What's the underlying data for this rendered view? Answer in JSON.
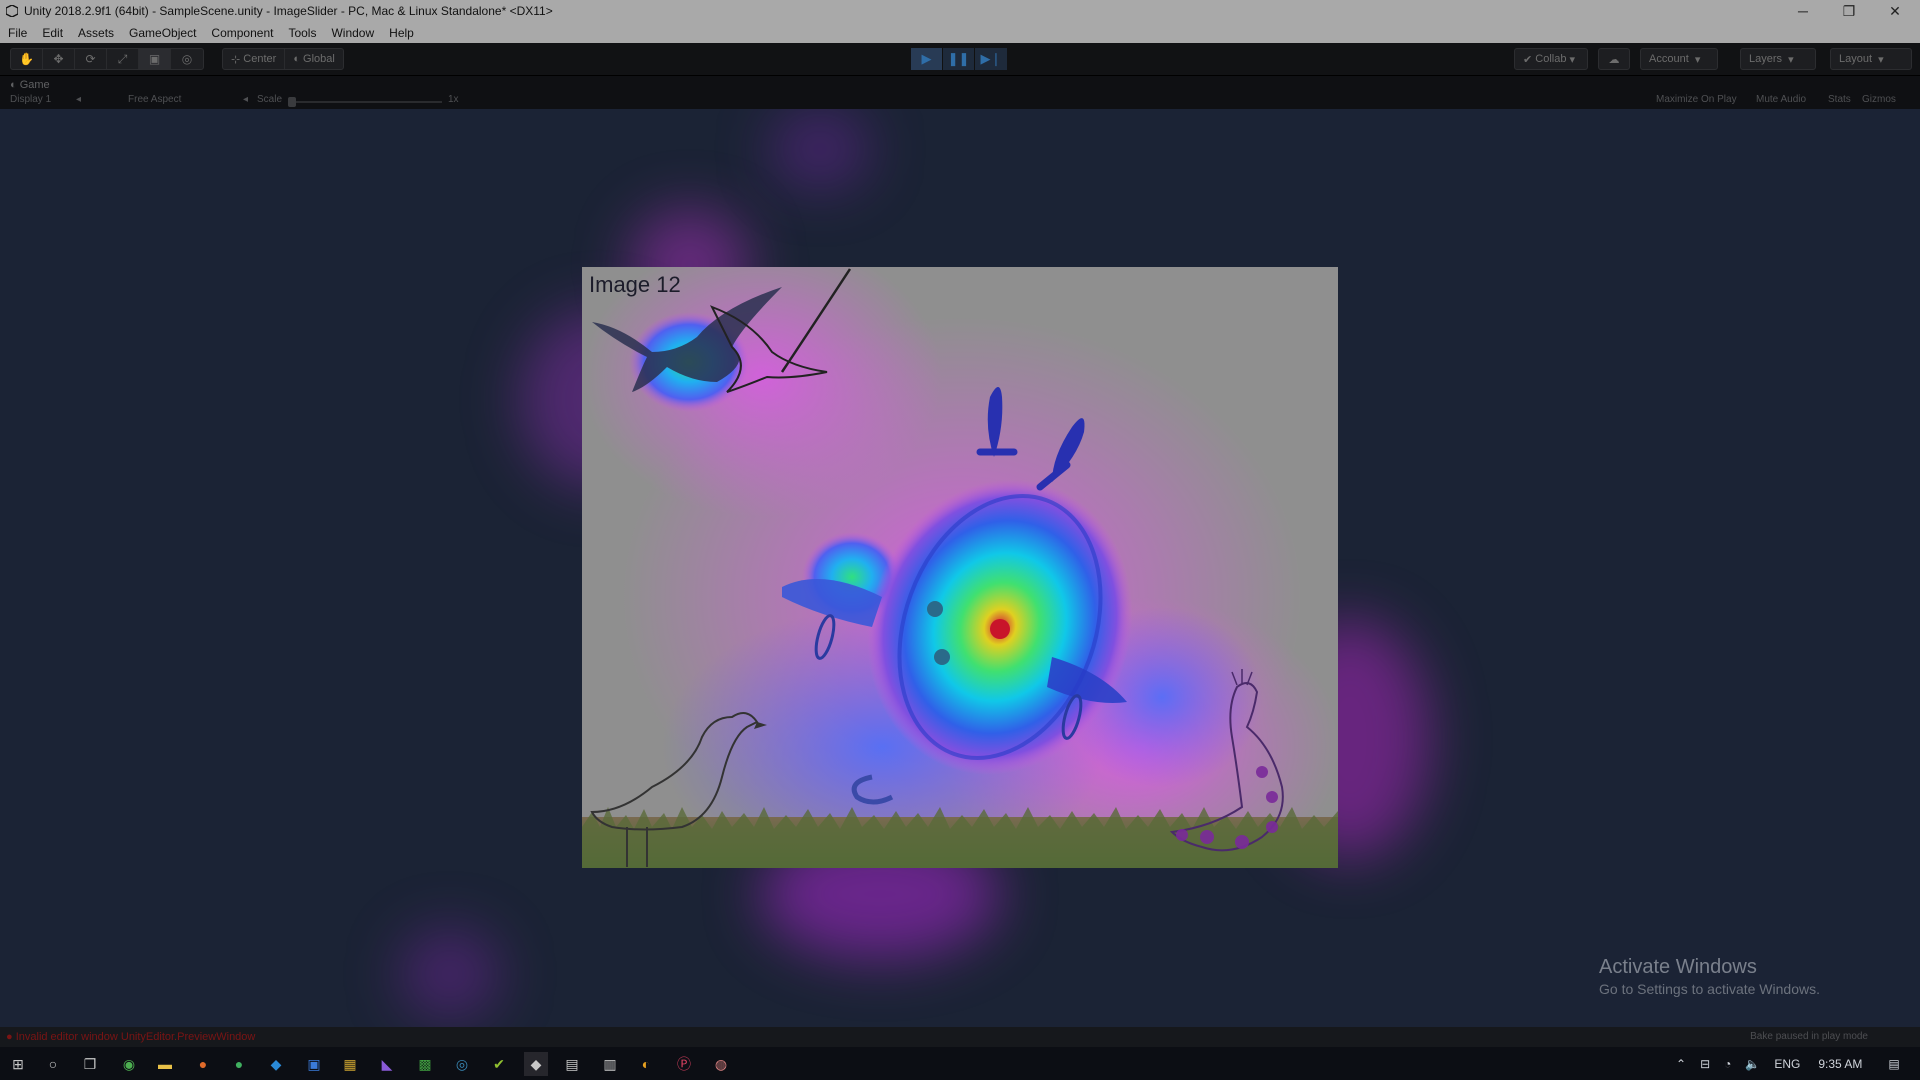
{
  "window": {
    "title": "Unity 2018.2.9f1 (64bit) - SampleScene.unity - ImageSlider - PC, Mac & Linux Standalone* <DX11>",
    "minimize": "─",
    "maximize": "❐",
    "close": "✕"
  },
  "menu": [
    "File",
    "Edit",
    "Assets",
    "GameObject",
    "Component",
    "Tools",
    "Window",
    "Help"
  ],
  "toolbar": {
    "pivot": "Center",
    "space": "Global",
    "collab": "Collab",
    "account": "Account",
    "layers": "Layers",
    "layout": "Layout"
  },
  "game": {
    "tab_label": "Game",
    "display": "Display 1",
    "aspect": "Free Aspect",
    "scale_label": "Scale",
    "scale_value": "1x",
    "maximize": "Maximize On Play",
    "mute": "Mute Audio",
    "stats": "Stats",
    "gizmos": "Gizmos"
  },
  "scene": {
    "image_label": "Image 12"
  },
  "watermark": {
    "title": "Activate Windows",
    "subtitle": "Go to Settings to activate Windows."
  },
  "status": {
    "error": "Invalid editor window UnityEditor.PreviewWindow",
    "bake": "Bake paused in play mode"
  },
  "tray": {
    "lang": "ENG",
    "time": "9:35 AM"
  },
  "colors": {
    "accent_play": "#2f6ea8",
    "panel_bg": "#8f8f8f",
    "viewport_bg": "#1b2335"
  }
}
